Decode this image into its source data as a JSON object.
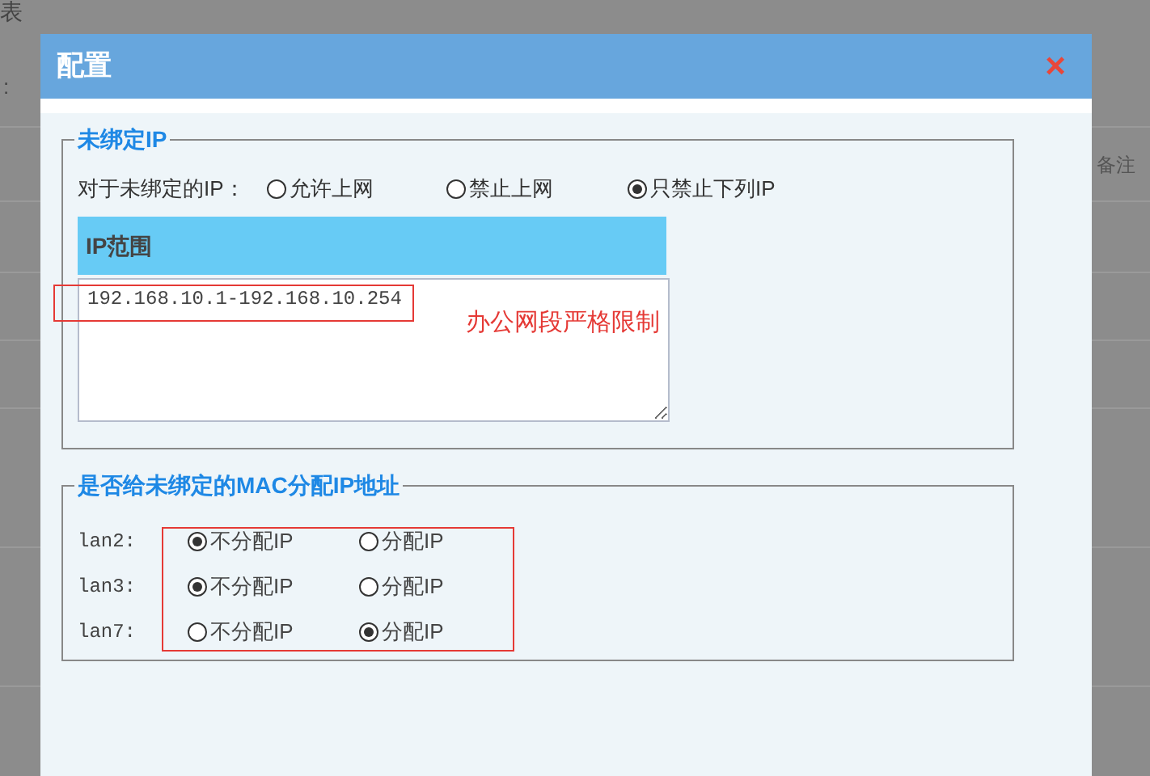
{
  "background": {
    "title_fragment": "表",
    "label_fragment": ":",
    "column_header": "备注"
  },
  "dialog": {
    "title": "配置",
    "close": "×"
  },
  "unbound_ip": {
    "legend": "未绑定IP",
    "prompt": "对于未绑定的IP：",
    "options": [
      {
        "label": "允许上网",
        "selected": false
      },
      {
        "label": "禁止上网",
        "selected": false
      },
      {
        "label": "只禁止下列IP",
        "selected": true
      }
    ],
    "table_header": "IP范围",
    "ranges": "192.168.10.1-192.168.10.254"
  },
  "annotation_text": "办公网段严格限制",
  "mac_assign": {
    "legend": "是否给未绑定的MAC分配IP地址",
    "rows": [
      {
        "interface": "lan2:",
        "options": [
          {
            "label": "不分配IP",
            "selected": true
          },
          {
            "label": "分配IP",
            "selected": false
          }
        ]
      },
      {
        "interface": "lan3:",
        "options": [
          {
            "label": "不分配IP",
            "selected": true
          },
          {
            "label": "分配IP",
            "selected": false
          }
        ]
      },
      {
        "interface": "lan7:",
        "options": [
          {
            "label": "不分配IP",
            "selected": false
          },
          {
            "label": "分配IP",
            "selected": true
          }
        ]
      }
    ]
  }
}
